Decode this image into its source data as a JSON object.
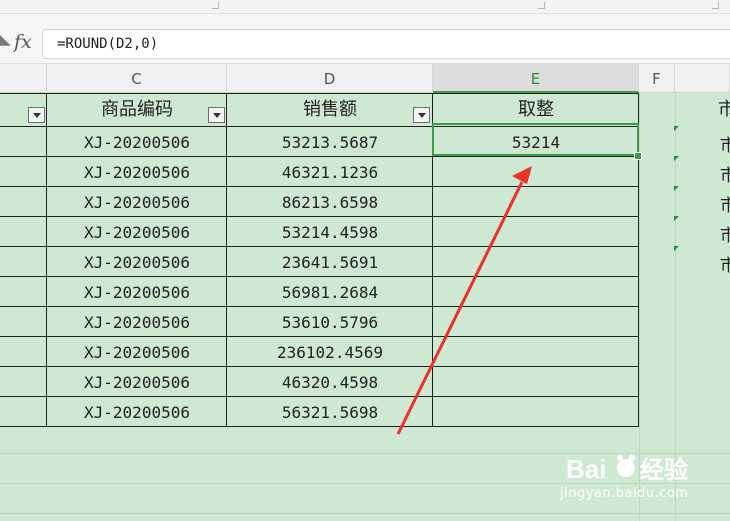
{
  "formula_bar": {
    "fx_label": "fx",
    "formula": "=ROUND(D2,0)"
  },
  "columns": {
    "C": "C",
    "D": "D",
    "E": "E",
    "F": "F"
  },
  "table": {
    "headers": {
      "product_code": "商品编码",
      "sales": "销售额",
      "rounded": "取整",
      "g_partial": "市"
    },
    "rows": [
      {
        "code": "XJ-20200506",
        "sales": "53213.5687",
        "rounded": "53214"
      },
      {
        "code": "XJ-20200506",
        "sales": "46321.1236",
        "rounded": ""
      },
      {
        "code": "XJ-20200506",
        "sales": "86213.6598",
        "rounded": ""
      },
      {
        "code": "XJ-20200506",
        "sales": "53214.4598",
        "rounded": ""
      },
      {
        "code": "XJ-20200506",
        "sales": "23641.5691",
        "rounded": ""
      },
      {
        "code": "XJ-20200506",
        "sales": "56981.2684",
        "rounded": ""
      },
      {
        "code": "XJ-20200506",
        "sales": "53610.5796",
        "rounded": ""
      },
      {
        "code": "XJ-20200506",
        "sales": "236102.4569",
        "rounded": ""
      },
      {
        "code": "XJ-20200506",
        "sales": "46320.4598",
        "rounded": ""
      },
      {
        "code": "XJ-20200506",
        "sales": "56321.5698",
        "rounded": ""
      }
    ],
    "g_rows": [
      "市",
      "市",
      "市",
      "市",
      "市"
    ]
  },
  "colors": {
    "sheet_bg": "#cfe8d2",
    "accent_green": "#3b9c49",
    "arrow_red": "#e8322a"
  },
  "watermark": {
    "text": "jingyan.baidu.com"
  }
}
